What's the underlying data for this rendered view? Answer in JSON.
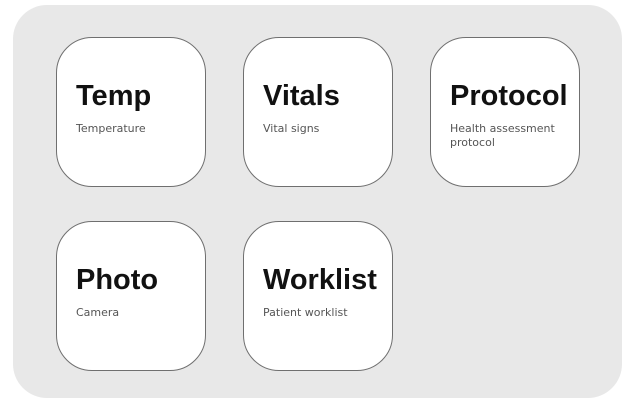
{
  "tiles": [
    {
      "title": "Temp",
      "subtitle": "Temperature"
    },
    {
      "title": "Vitals",
      "subtitle": "Vital signs"
    },
    {
      "title": "Protocol",
      "subtitle": "Health assessment protocol"
    },
    {
      "title": "Photo",
      "subtitle": "Camera"
    },
    {
      "title": "Worklist",
      "subtitle": "Patient worklist"
    }
  ]
}
